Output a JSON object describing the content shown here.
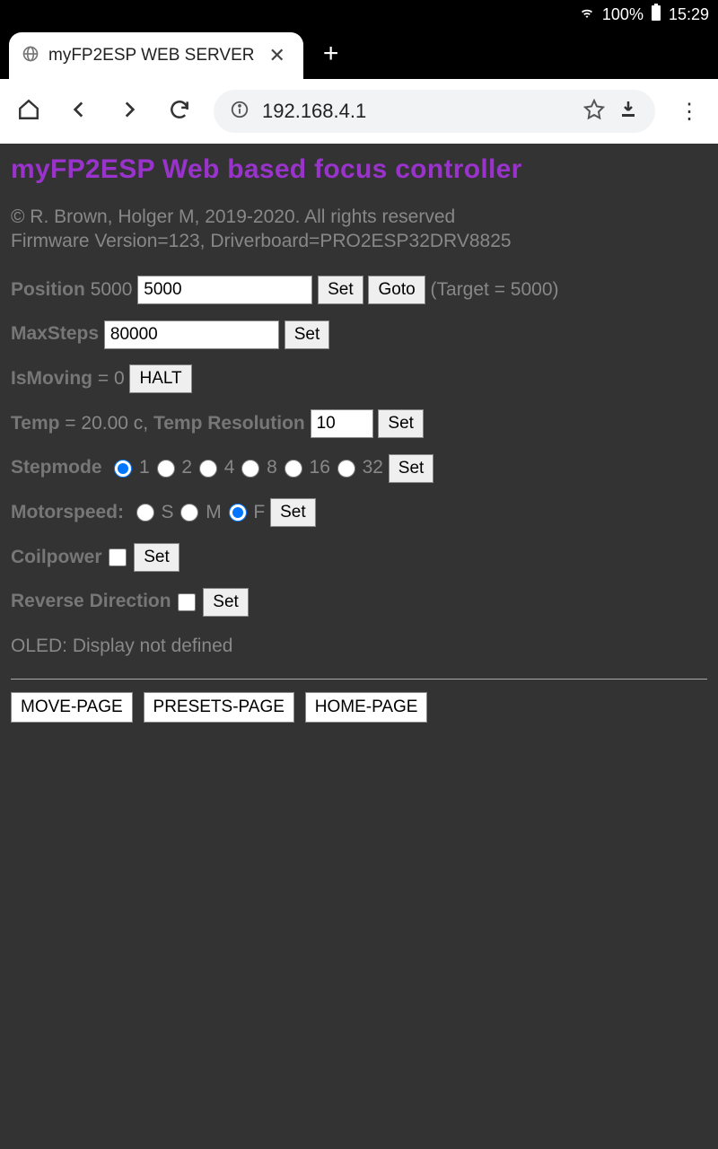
{
  "status": {
    "battery": "100%",
    "time": "15:29"
  },
  "tab": {
    "title": "myFP2ESP WEB SERVER"
  },
  "address": {
    "url": "192.168.4.1"
  },
  "page": {
    "heading": "myFP2ESP Web based focus controller",
    "copyright1": "© R. Brown, Holger M, 2019-2020. All rights reserved",
    "copyright2": "Firmware Version=123, Driverboard=PRO2ESP32DRV8825",
    "position": {
      "label": "Position",
      "current": "5000",
      "input": "5000",
      "set": "Set",
      "goto": "Goto",
      "target": "(Target = 5000)"
    },
    "maxsteps": {
      "label": "MaxSteps",
      "input": "80000",
      "set": "Set"
    },
    "ismoving": {
      "label": "IsMoving",
      "eq": " = 0 ",
      "halt": "HALT"
    },
    "temp": {
      "label": "Temp",
      "eq": " = 20.00 c, ",
      "reslabel": "Temp Resolution",
      "input": "10",
      "set": "Set"
    },
    "stepmode": {
      "label": "Stepmode",
      "o1": "1",
      "o2": "2",
      "o4": "4",
      "o8": "8",
      "o16": "16",
      "o32": "32",
      "set": "Set"
    },
    "motorspeed": {
      "label": "Motorspeed:",
      "s": "S",
      "m": "M",
      "f": "F",
      "set": "Set"
    },
    "coilpower": {
      "label": "Coilpower",
      "set": "Set"
    },
    "reverse": {
      "label": "Reverse Direction",
      "set": "Set"
    },
    "oled": "OLED: Display not defined",
    "footer": {
      "move": "MOVE-PAGE",
      "presets": "PRESETS-PAGE",
      "home": "HOME-PAGE"
    }
  }
}
